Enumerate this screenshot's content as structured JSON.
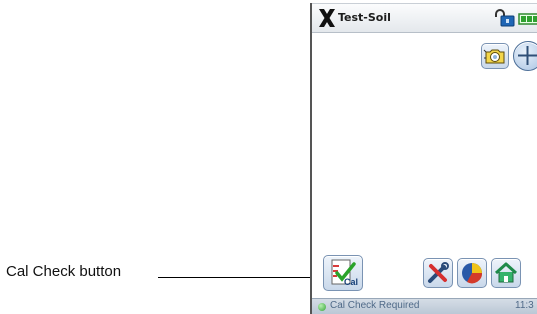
{
  "annotation": {
    "label": "Cal Check button"
  },
  "app": {
    "title": "Test-Soil",
    "logo_icon": "x-logo-icon",
    "lock_icon": "unlocked-padlock-icon",
    "battery_icon": "battery-icon"
  },
  "toolbar": {
    "camera_icon": "camera-icon",
    "add_icon": "plus-circle-icon",
    "calcheck_label": "Cal",
    "tools_icon": "wrench-screwdriver-icon",
    "chart_icon": "pie-chart-icon",
    "home_icon": "home-icon"
  },
  "status": {
    "message": "Cal Check Required",
    "time": "11:3",
    "indicator_color": "#37a437"
  },
  "colors": {
    "accent": "#4d6f98",
    "status_text": "#4f6a88"
  }
}
